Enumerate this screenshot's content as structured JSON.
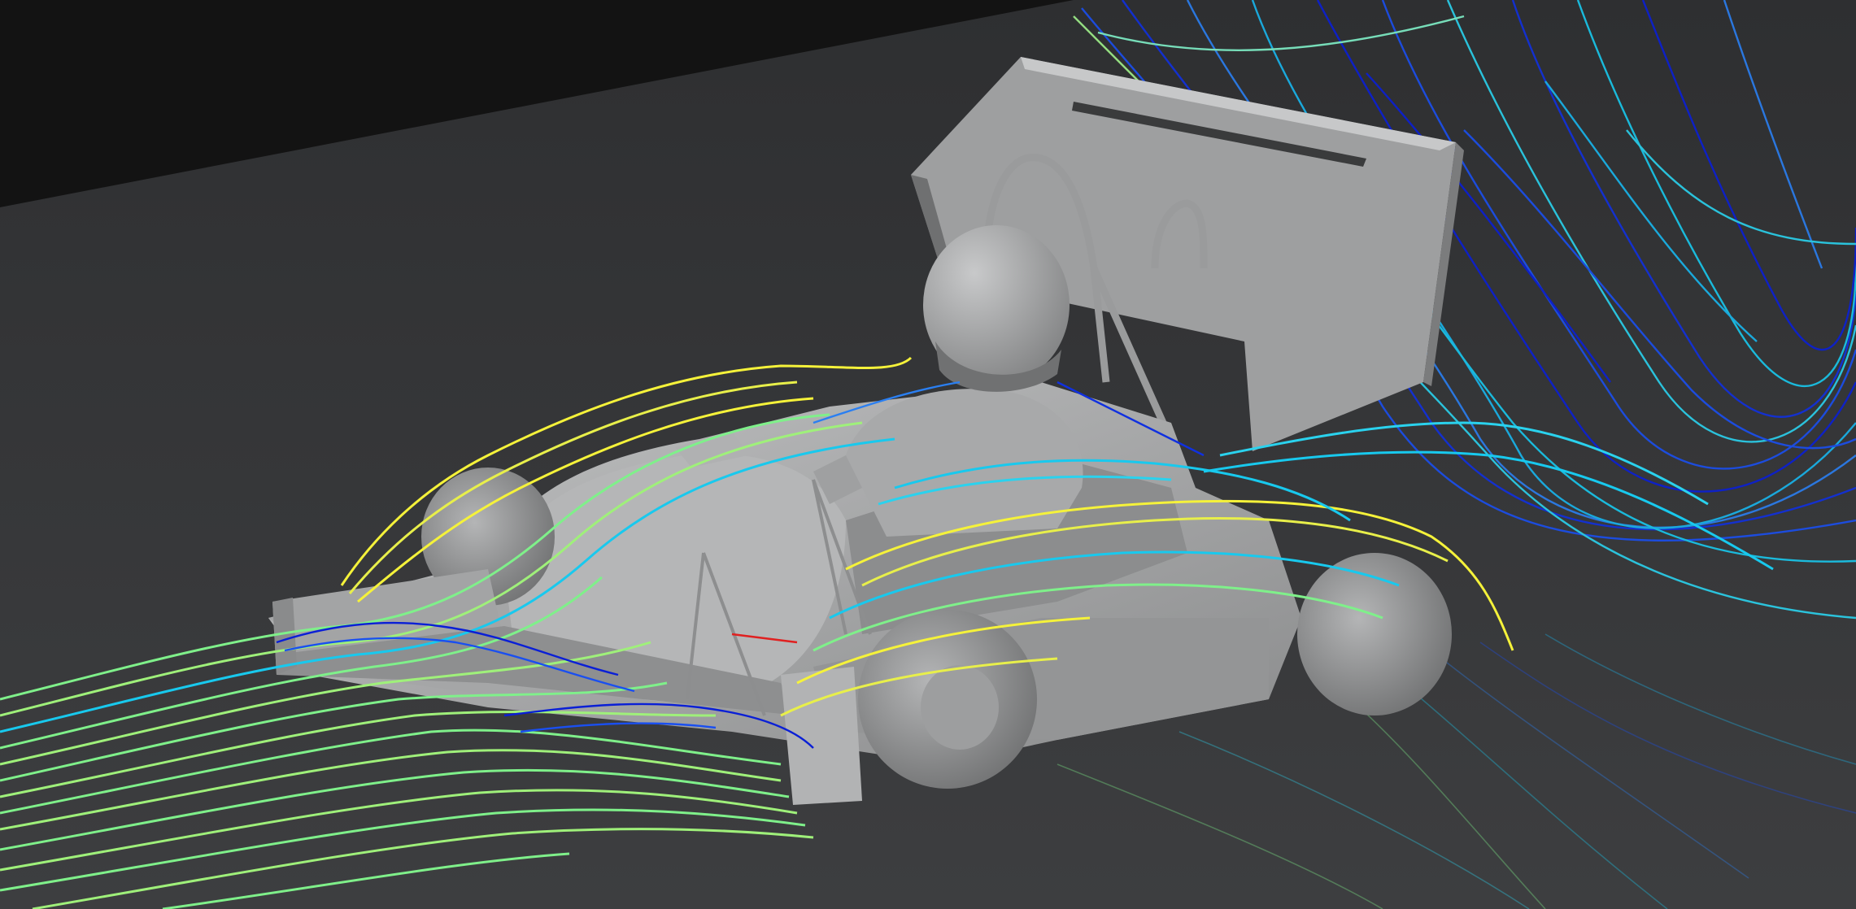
{
  "scene": {
    "subject": "formula-student-race-car",
    "colors": {
      "backdrop_top": "#121212",
      "floor": "#3a3b3d",
      "body": "#a9aaab",
      "body_shadow": "#7d7e80",
      "tire": "#8f9091",
      "streamline_low": "#0a1fd6",
      "streamline_mid": "#18c9ee",
      "streamline_midhigh": "#7ff08a",
      "streamline_high": "#f5f23a",
      "streamline_peak": "#e02020"
    },
    "icons": [
      "car-body",
      "driver-helmet",
      "rear-wing",
      "front-wing",
      "wheel",
      "airflow-streamlines"
    ]
  }
}
